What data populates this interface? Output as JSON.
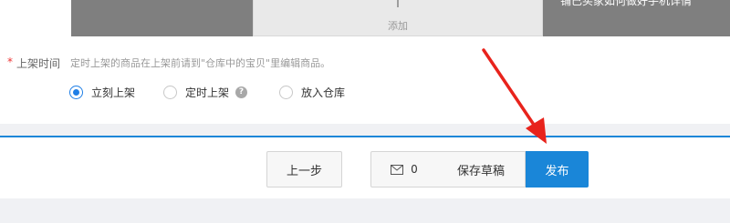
{
  "upload": {
    "add_label": "添加",
    "banner_text": "铺已买家如何做好手机详情"
  },
  "listing_time": {
    "required_mark": "*",
    "label": "上架时间",
    "hint": "定时上架的商品在上架前请到\"仓库中的宝贝\"里编辑商品。",
    "options": [
      {
        "label": "立刻上架",
        "checked": true
      },
      {
        "label": "定时上架",
        "checked": false
      },
      {
        "label": "放入仓库",
        "checked": false
      }
    ],
    "help_icon": "question-icon"
  },
  "actions": {
    "prev_label": "上一步",
    "message_count": "0",
    "message_icon": "mail-icon",
    "save_draft_label": "保存草稿",
    "publish_label": "发布"
  },
  "colors": {
    "accent": "#1a86d8",
    "annotation_arrow": "#e8231c",
    "required": "#e33333"
  }
}
